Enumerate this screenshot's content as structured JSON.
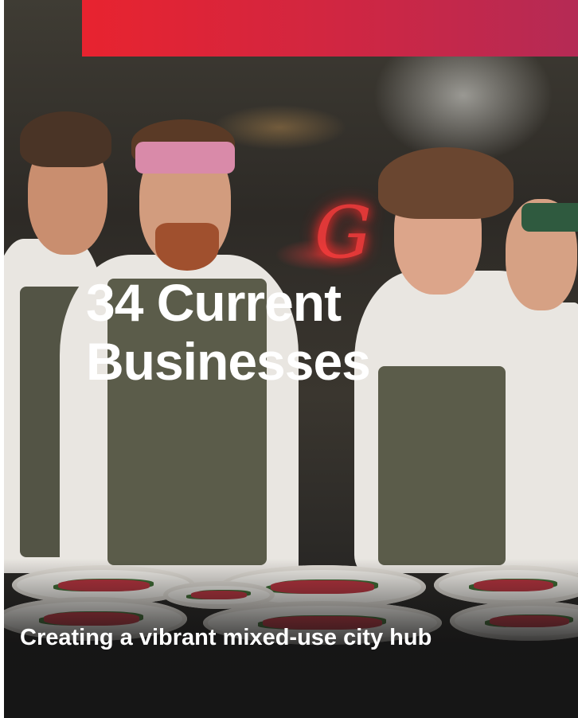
{
  "promo_card": {
    "headline": "34 Current Businesses",
    "tagline": "Creating a vibrant mixed-use city hub",
    "photo_icon": "photo-image",
    "accent_color": "#e8232f"
  }
}
